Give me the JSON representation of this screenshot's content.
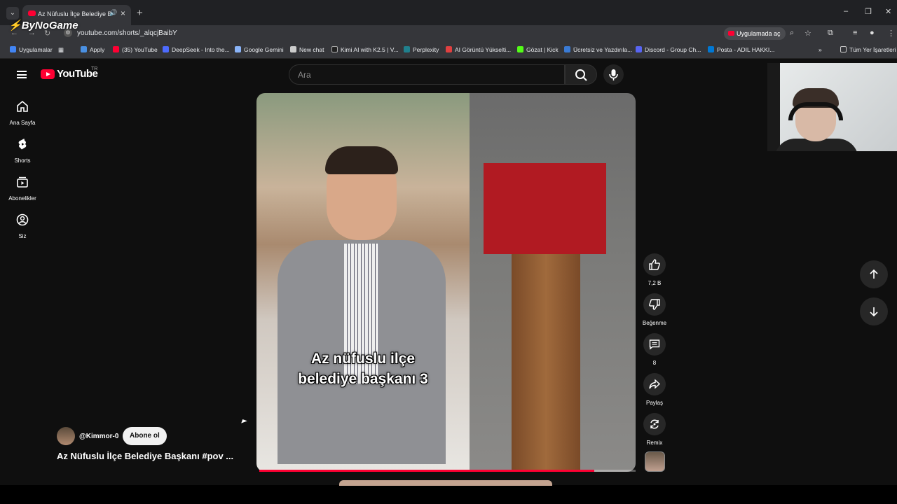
{
  "browser": {
    "tab_title": "Az Nüfuslu İlçe Belediye Ba",
    "url": "youtube.com/shorts/_alqcjBaibY",
    "open_in_app": "Uygulamada aç",
    "watermark": "ByNoGame",
    "bookmarks": [
      {
        "label": "Uygulamalar",
        "color": "#4285f4"
      },
      {
        "label": "Apply",
        "color": "#4a90e2"
      },
      {
        "label": "(35) YouTube",
        "color": "#ff0033"
      },
      {
        "label": "DeepSeek - Into the...",
        "color": "#4d6bfe"
      },
      {
        "label": "Google Gemini",
        "color": "#8ab4f8"
      },
      {
        "label": "New chat",
        "color": "#cccccc"
      },
      {
        "label": "Kimi AI with K2.5 | V...",
        "color": "#222222"
      },
      {
        "label": "Perplexity",
        "color": "#20808d"
      },
      {
        "label": "AI Görüntü Yükselti...",
        "color": "#e04040"
      },
      {
        "label": "Gözat | Kick",
        "color": "#53fc18"
      },
      {
        "label": "Ücretsiz ve Yazdırıla...",
        "color": "#3a7bd5"
      },
      {
        "label": "Discord - Group Ch...",
        "color": "#5865f2"
      },
      {
        "label": "Posta - ADIL HAKKI...",
        "color": "#0078d4"
      }
    ],
    "all_bookmarks": "Tüm Yer İşaretleri"
  },
  "youtube": {
    "logo_text": "YouTube",
    "country": "TR",
    "search_placeholder": "Ara",
    "sidebar": [
      {
        "label": "Ana Sayfa",
        "icon": "home-icon"
      },
      {
        "label": "Shorts",
        "icon": "shorts-icon"
      },
      {
        "label": "Abonelikler",
        "icon": "subscriptions-icon"
      },
      {
        "label": "Siz",
        "icon": "you-icon"
      }
    ],
    "short": {
      "caption_line1": "Az nüfuslu ilçe",
      "caption_line2": "belediye başkanı 3",
      "channel": "@Kimmor-0",
      "subscribe": "Abone ol",
      "title": "Az Nüfuslu İlçe Belediye Başkanı #pov ...",
      "progress": 0.89
    },
    "actions": {
      "likes": "7,2 B",
      "dislike": "Beğenme",
      "comments": "8",
      "share": "Paylaş",
      "remix": "Remix"
    },
    "accent": "#ff0033"
  }
}
